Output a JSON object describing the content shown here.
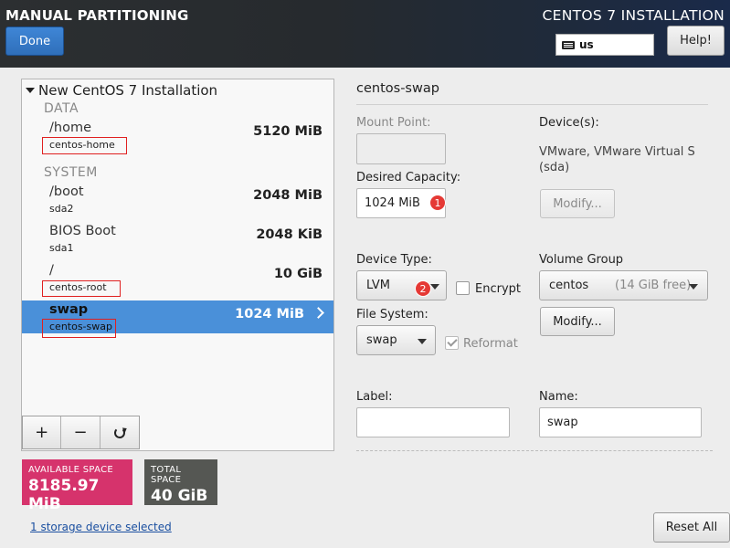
{
  "header": {
    "title": "MANUAL PARTITIONING",
    "installer_title": "CENTOS 7 INSTALLATION",
    "done_label": "Done",
    "keyboard_layout": "us",
    "help_label": "Help!"
  },
  "tree": {
    "root_label": "New CentOS 7 Installation",
    "groups": [
      {
        "label": "DATA",
        "items": [
          {
            "name": "/home",
            "sub": "centos-home",
            "size": "5120 MiB"
          }
        ]
      },
      {
        "label": "SYSTEM",
        "items": [
          {
            "name": "/boot",
            "sub": "sda2",
            "size": "2048 MiB"
          },
          {
            "name": "BIOS Boot",
            "sub": "sda1",
            "size": "2048 KiB"
          },
          {
            "name": "/",
            "sub": "centos-root",
            "size": "10 GiB"
          },
          {
            "name": "swap",
            "sub": "centos-swap",
            "size": "1024 MiB",
            "selected": true
          }
        ]
      }
    ]
  },
  "toolbar": {
    "add": "+",
    "remove": "−"
  },
  "space": {
    "available_label": "AVAILABLE SPACE",
    "available_value": "8185.97 MiB",
    "total_label": "TOTAL SPACE",
    "total_value": "40 GiB"
  },
  "storage_link": "1 storage device selected",
  "detail": {
    "title": "centos-swap",
    "mount_point_label": "Mount Point:",
    "mount_point_value": "",
    "desired_capacity_label": "Desired Capacity:",
    "desired_capacity_value": "1024 MiB",
    "devices_label": "Device(s):",
    "devices_value_line1": "VMware, VMware Virtual S",
    "devices_value_line2": "(sda)",
    "modify_label": "Modify...",
    "device_type_label": "Device Type:",
    "device_type_value": "LVM",
    "encrypt_label": "Encrypt",
    "volume_group_label": "Volume Group",
    "volume_group_value": "centos",
    "volume_group_free": "(14 GiB free)",
    "file_system_label": "File System:",
    "file_system_value": "swap",
    "reformat_label": "Reformat",
    "label_label": "Label:",
    "label_value": "",
    "name_label": "Name:",
    "name_value": "swap",
    "badge1": "1",
    "badge2": "2"
  },
  "reset_label": "Reset All",
  "colors": {
    "accent": "#4a90d9",
    "available": "#d6336c",
    "total": "#555753",
    "badge": "#e53935"
  }
}
